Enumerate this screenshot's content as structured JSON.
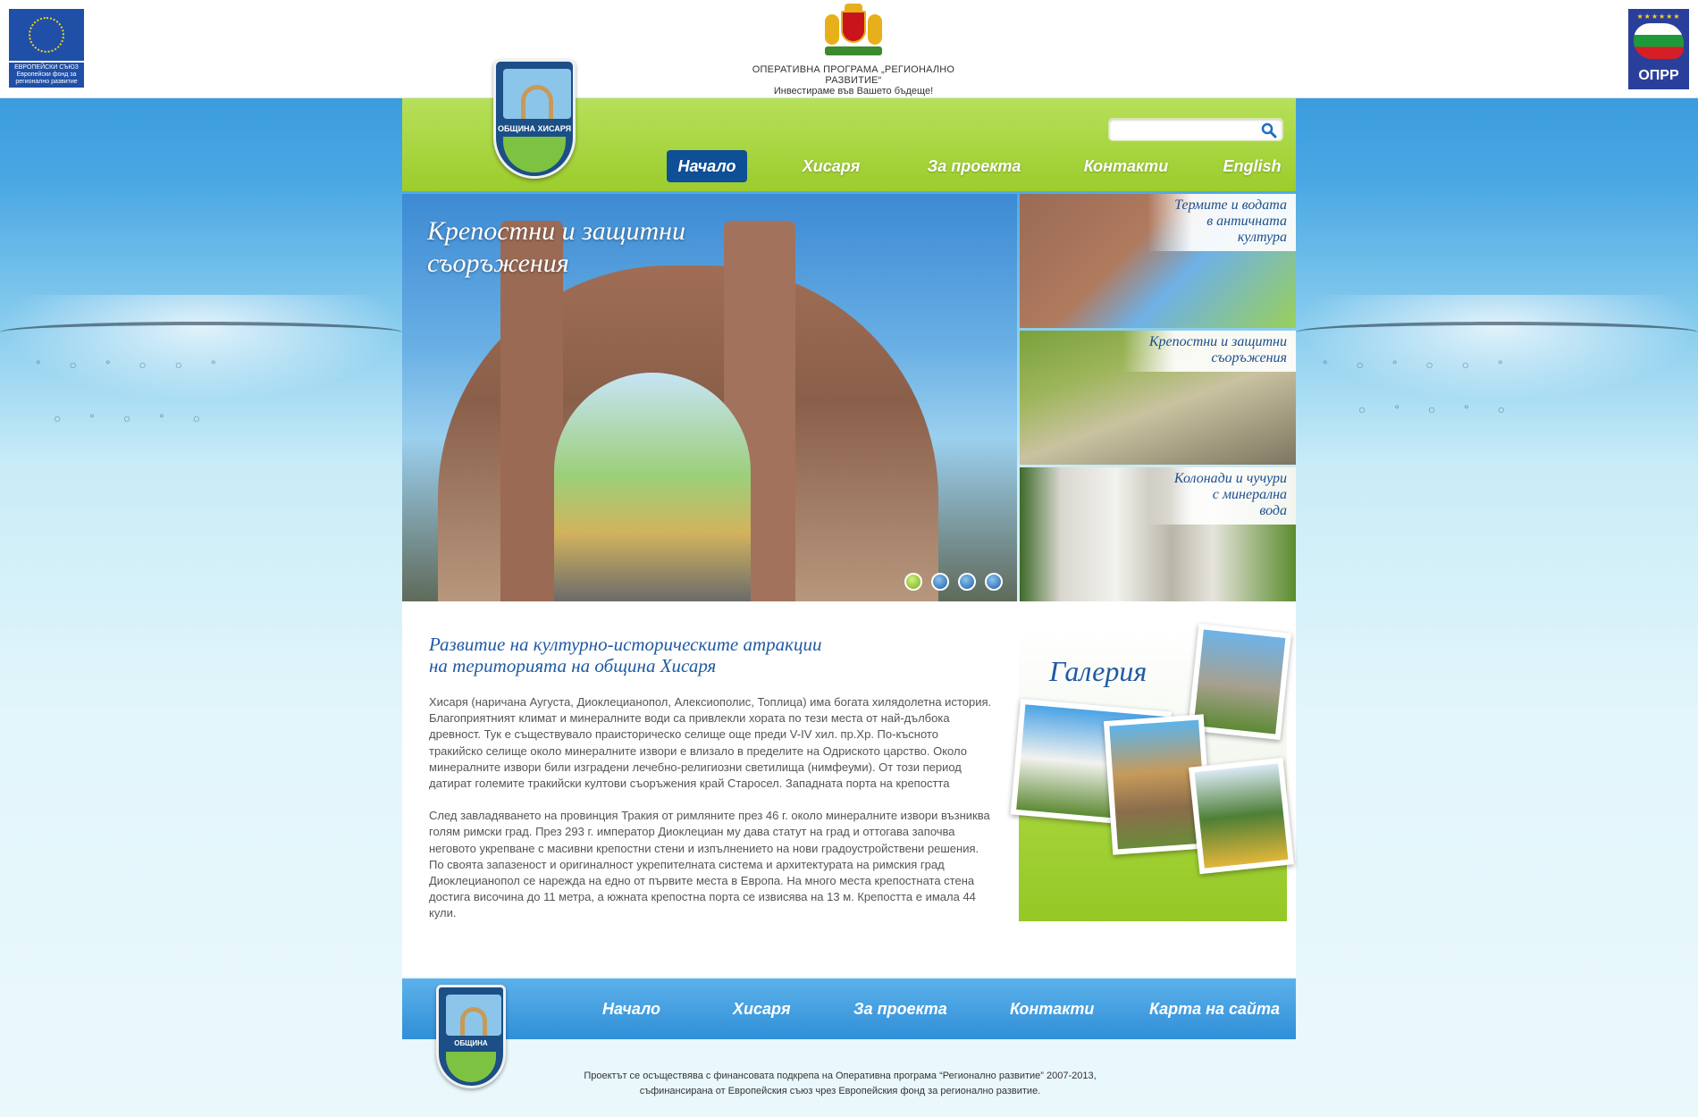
{
  "top": {
    "eu_caption": "ЕВРОПЕЙСКИ СЪЮЗ Европейски фонд за регионално развитие",
    "op_line1": "ОПЕРАТИВНА ПРОГРАМА „РЕГИОНАЛНО РАЗВИТИЕ“",
    "op_line2": "Инвестираме във Вашето бъдеще!",
    "oprr_label": "ОПРР",
    "oprr_stars": "★★★★★★"
  },
  "header": {
    "crest_label": "ОБЩИНА ХИСАРЯ",
    "search": {
      "value": "",
      "placeholder": ""
    },
    "nav": [
      {
        "label": "Начало"
      },
      {
        "label": "Хисаря"
      },
      {
        "label": "За проекта"
      },
      {
        "label": "Контакти"
      },
      {
        "label": "English"
      }
    ]
  },
  "slider": {
    "title": "Крепостни и защитни съоръжения",
    "active_dot": 1
  },
  "thumbs": [
    {
      "label_line1": "Термите и водата",
      "label_line2": "в античната",
      "label_line3": "култура"
    },
    {
      "label_line1": "Крепостни и защитни",
      "label_line2": "съоръжения"
    },
    {
      "label_line1": "Колонади и чучури",
      "label_line2": "с минерална",
      "label_line3": "вода"
    }
  ],
  "content": {
    "title_line1": "Развитие на културно-историческите атракции",
    "title_line2": "на територията на община Хисаря",
    "paragraph1": "Хисаря (наричана Аугуста, Диоклецианопол, Алексиополис, Топлица) има богата хилядолетна история. Благоприятният климат и минералните води са привлекли хората по тези места от най-дълбока древност. Тук е съществувало праисторическо селище още преди V-IV хил. пр.Хр. По-късното тракийско селище около минералните извори е влизало в пределите на Одриското царство. Около минералните извори били изградени лечебно-религиозни светилища (нимфеуми). От този период датират големите тракийски култови съоръжения край Старосел. Западната порта на крепостта",
    "paragraph2": "След завладяването на провинция Тракия от римляните през 46 г. около минералните извори възниква голям римски град. През 293 г. император Диоклециан му дава статут на град и оттогава започва неговото укрепване с масивни крепостни стени и изпълнението на нови градоустройствени решения. По своята запазеност и оригиналност укрепителната система и архитектурата на римския град Диоклецианопол се нарежда на едно от първите места в Европа. На много места крепостната стена достига височина до 11 метра, а южната крепостна порта се извисява на 13 м. Крепостта е имала 44 кули."
  },
  "gallery": {
    "title": "Галерия"
  },
  "footer": {
    "nav": [
      {
        "label": "Начало"
      },
      {
        "label": "Хисаря"
      },
      {
        "label": "За проекта"
      },
      {
        "label": "Контакти"
      },
      {
        "label": "Карта на сайта"
      }
    ],
    "crest_label": "ОБЩИНА ХИСАРЯ",
    "text_line1": "Проектът се осъществява с финансовата подкрепа на Оперативна програма “Регионално развитие” 2007-2013,",
    "text_line2": "съфинансирана от Европейския съюз чрез Европейския фонд за регионално развитие."
  },
  "colors": {
    "green_header": "#9ccc2c",
    "nav_active": "#0e4f95",
    "title_blue": "#1f5aa3",
    "footer_blue": "#2f8fd8"
  },
  "icons": {
    "search": "search-icon"
  }
}
